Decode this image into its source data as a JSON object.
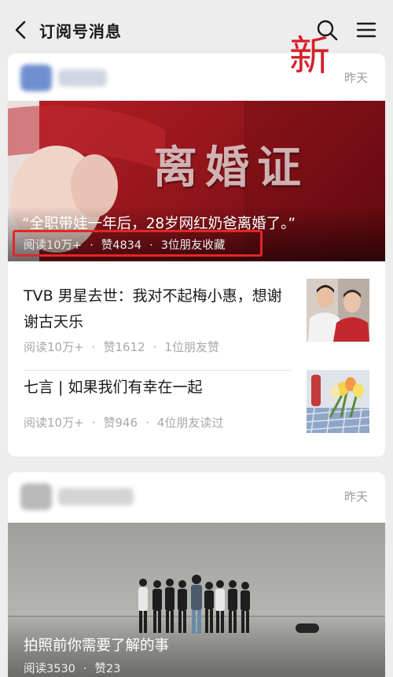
{
  "header": {
    "title": "订阅号消息",
    "back_icon": "chevron-left-icon",
    "search_icon": "search-icon",
    "menu_icon": "menu-icon"
  },
  "annotation": {
    "new_label": "新",
    "color": "#d6202a"
  },
  "cards": [
    {
      "time": "昨天",
      "cover": {
        "stamp_text": "离婚证",
        "title": "“全职带娃一年后，28岁网红奶爸离婚了。”",
        "meta": {
          "reads": "阅读10万+",
          "likes": "赞4834",
          "social": "3位朋友收藏"
        }
      },
      "items": [
        {
          "title": "TVB 男星去世：我对不起梅小惠，想谢谢古天乐",
          "reads": "阅读10万+",
          "likes": "赞1612",
          "social": "1位朋友赞"
        },
        {
          "title": "七言 | 如果我们有幸在一起",
          "reads": "阅读10万+",
          "likes": "赞946",
          "social": "4位朋友读过"
        }
      ]
    },
    {
      "time": "昨天",
      "cover": {
        "title": "拍照前你需要了解的事",
        "meta": {
          "reads": "阅读3530",
          "likes": "赞23"
        }
      }
    }
  ],
  "separator": "·",
  "colors": {
    "background": "#ededed",
    "card": "#ffffff",
    "highlight": "#e32626",
    "meta_text": "#a8a8a8"
  }
}
